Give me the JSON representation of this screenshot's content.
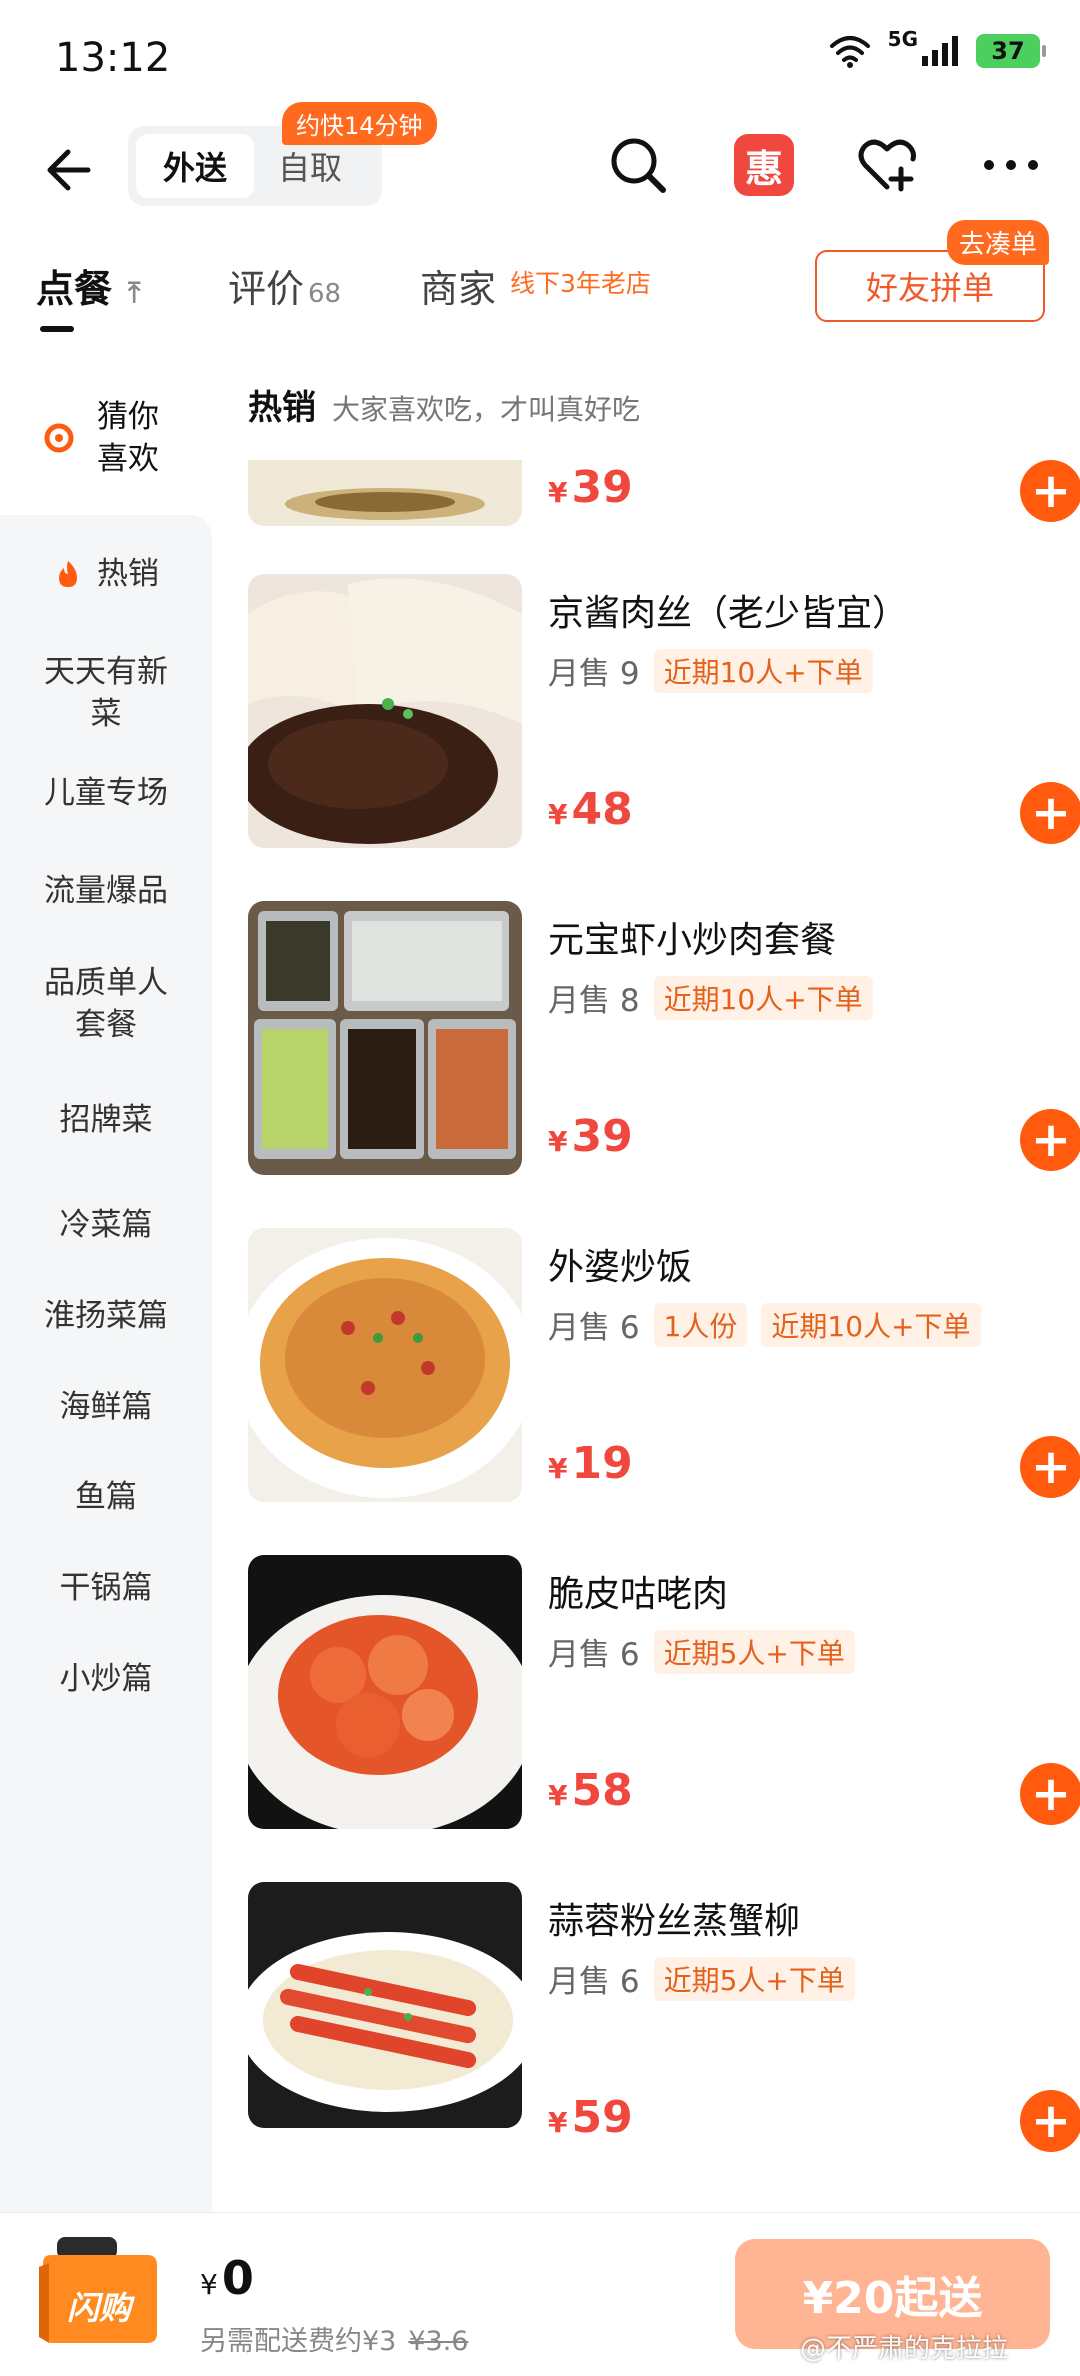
{
  "status_bar": {
    "time": "13:12",
    "network": "5G",
    "battery": "37"
  },
  "nav": {
    "mode_active": "外送",
    "mode_other": "自取",
    "eta_badge": "约快14分钟",
    "promo_icon_label": "惠",
    "icons": [
      "back-arrow-icon",
      "search-icon",
      "promo-icon",
      "favorite-add-icon",
      "more-icon"
    ]
  },
  "tabs": {
    "order": "点餐",
    "reviews": "评价",
    "reviews_count": "68",
    "merchant": "商家",
    "merchant_sub": "线下3年老店",
    "group_order": "好友拼单",
    "group_order_badge": "去凑单"
  },
  "sidebar": {
    "items": [
      {
        "label": "猜你喜欢"
      },
      {
        "label": "热销"
      },
      {
        "label": "天天有新菜"
      },
      {
        "label": "儿童专场"
      },
      {
        "label": "流量爆品"
      },
      {
        "label": "品质单人套餐"
      },
      {
        "label": "招牌菜"
      },
      {
        "label": "冷菜篇"
      },
      {
        "label": "淮扬菜篇"
      },
      {
        "label": "海鲜篇"
      },
      {
        "label": "鱼篇"
      },
      {
        "label": "干锅篇"
      },
      {
        "label": "小炒篇"
      }
    ]
  },
  "section": {
    "title": "热销",
    "subtitle": "大家喜欢吃，才叫真好吃"
  },
  "currency": "¥",
  "products": [
    {
      "name": "",
      "price": "39"
    },
    {
      "name": "京酱肉丝（老少皆宜）",
      "sales": "月售 9",
      "tags": [
        "近期10人+下单"
      ],
      "price": "48"
    },
    {
      "name": "元宝虾小炒肉套餐",
      "sales": "月售 8",
      "tags": [
        "近期10人+下单"
      ],
      "price": "39"
    },
    {
      "name": "外婆炒饭",
      "sales": "月售 6",
      "tags": [
        "1人份",
        "近期10人+下单"
      ],
      "price": "19"
    },
    {
      "name": "脆皮咕咾肉",
      "sales": "月售 6",
      "tags": [
        "近期5人+下单"
      ],
      "price": "58"
    },
    {
      "name": "蒜蓉粉丝蒸蟹柳",
      "sales": "月售 6",
      "tags": [
        "近期5人+下单"
      ],
      "price": "59"
    }
  ],
  "cart": {
    "total": "0",
    "fee_text": "另需配送费约¥3",
    "fee_original": "¥3.6",
    "min_order": "¥20起送",
    "icon_label": "闪购"
  },
  "watermark": "@不严肃的克拉拉",
  "colors": {
    "accent": "#ff5a0e",
    "price": "#f0483e",
    "tag_text": "#e3631d",
    "tag_bg": "#fff1e6"
  }
}
